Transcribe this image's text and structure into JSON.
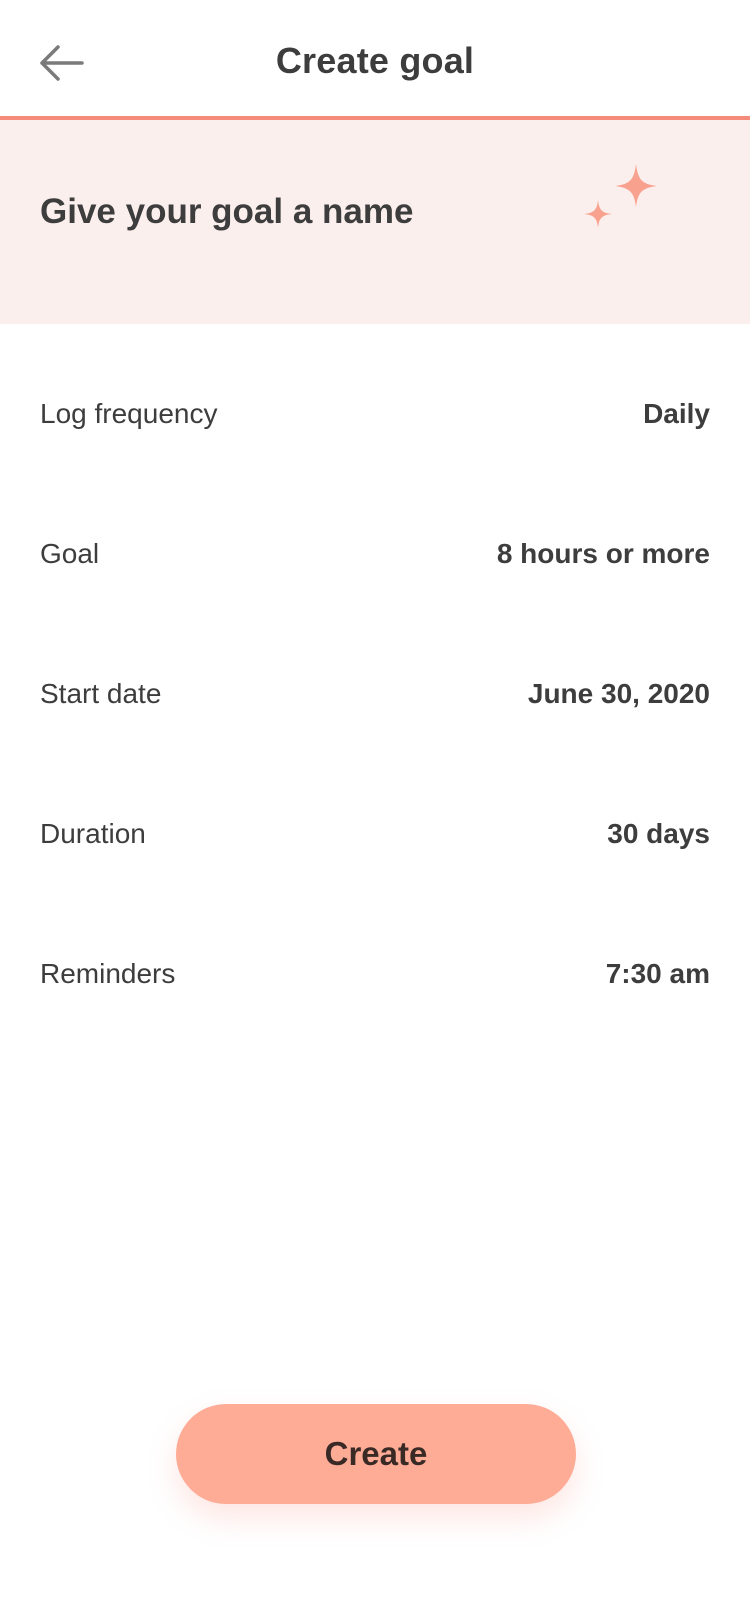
{
  "header": {
    "title": "Create goal",
    "back_icon": "arrow-left-icon"
  },
  "name_banner": {
    "placeholder": "Give your goal a name",
    "illustration": "moon-stars-icon"
  },
  "settings": [
    {
      "label": "Log frequency",
      "value": "Daily"
    },
    {
      "label": "Goal",
      "value": "8 hours or more"
    },
    {
      "label": "Start date",
      "value": "June 30, 2020"
    },
    {
      "label": "Duration",
      "value": "30 days"
    },
    {
      "label": "Reminders",
      "value": "7:30 am"
    }
  ],
  "create_button": {
    "label": "Create"
  },
  "colors": {
    "accent": "#f48b7b",
    "banner_bg": "#fbefed",
    "button_bg": "#ffac97",
    "text": "#3d3d3d"
  }
}
